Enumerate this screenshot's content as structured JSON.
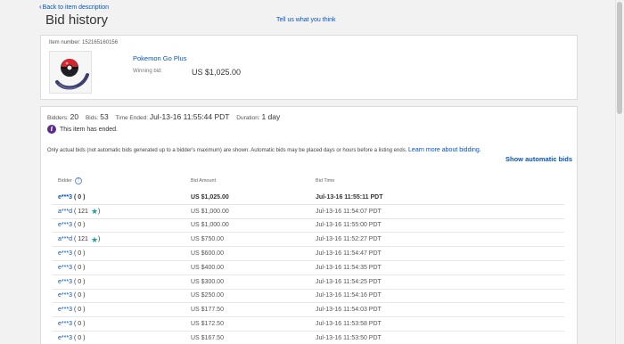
{
  "nav": {
    "back_label": "Back to item description"
  },
  "page": {
    "title": "Bid history",
    "feedback_label": "Tell us what you think"
  },
  "item": {
    "number_label": "Item number:",
    "number": "152165160156",
    "title": "Pokemon Go Plus",
    "winning_label": "Winning bid:",
    "winning_value": "US $1,025.00"
  },
  "summary": {
    "bidders_label": "Bidders:",
    "bidders": "20",
    "bids_label": "Bids:",
    "bids": "53",
    "ended_label": "Time Ended:",
    "ended_value": "Jul-13-16 11:55:44 PDT",
    "duration_label": "Duration:",
    "duration_value": "1 day",
    "ended_message": "This item has ended.",
    "note": "Only actual bids (not automatic bids generated up to a bidder's maximum) are shown. Automatic bids may be placed days or hours before a listing ends.",
    "learn_more": "Learn more about bidding.",
    "show_auto": "Show automatic bids"
  },
  "table": {
    "headers": {
      "bidder": "Bidder",
      "amount": "Bid Amount",
      "time": "Bid Time"
    },
    "rows": [
      {
        "bidder": "e***3",
        "score": "( 0 )",
        "star": false,
        "amount": "US $1,025.00",
        "time": "Jul-13-16 11:55:11 PDT"
      },
      {
        "bidder": "a***d",
        "score": "( 121",
        "star": true,
        "amount": "US $1,000.00",
        "time": "Jul-13-16 11:54:07 PDT"
      },
      {
        "bidder": "e***3",
        "score": "( 0 )",
        "star": false,
        "amount": "US $1,000.00",
        "time": "Jul-13-16 11:55:00 PDT"
      },
      {
        "bidder": "a***d",
        "score": "( 121",
        "star": true,
        "amount": "US $750.00",
        "time": "Jul-13-16 11:52:27 PDT"
      },
      {
        "bidder": "e***3",
        "score": "( 0 )",
        "star": false,
        "amount": "US $600.00",
        "time": "Jul-13-16 11:54:47 PDT"
      },
      {
        "bidder": "e***3",
        "score": "( 0 )",
        "star": false,
        "amount": "US $400.00",
        "time": "Jul-13-16 11:54:35 PDT"
      },
      {
        "bidder": "e***3",
        "score": "( 0 )",
        "star": false,
        "amount": "US $300.00",
        "time": "Jul-13-16 11:54:25 PDT"
      },
      {
        "bidder": "e***3",
        "score": "( 0 )",
        "star": false,
        "amount": "US $250.00",
        "time": "Jul-13-16 11:54:16 PDT"
      },
      {
        "bidder": "e***3",
        "score": "( 0 )",
        "star": false,
        "amount": "US $177.50",
        "time": "Jul-13-16 11:54:03 PDT"
      },
      {
        "bidder": "e***3",
        "score": "( 0 )",
        "star": false,
        "amount": "US $172.50",
        "time": "Jul-13-16 11:53:58 PDT"
      },
      {
        "bidder": "e***3",
        "score": "( 0 )",
        "star": false,
        "amount": "US $167.50",
        "time": "Jul-13-16 11:53:50 PDT"
      }
    ]
  },
  "colors": {
    "link": "#0654ba",
    "info_badge": "#5b2c8c",
    "star": "#1aa3a3"
  }
}
